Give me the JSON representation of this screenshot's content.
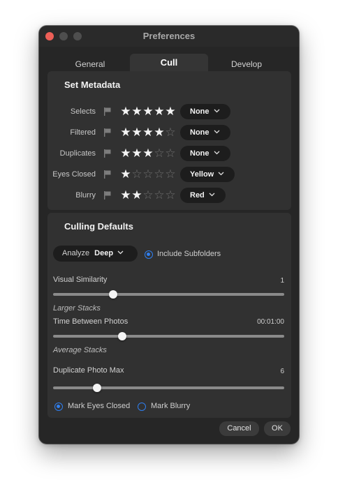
{
  "window": {
    "title": "Preferences"
  },
  "tabs": [
    {
      "label": "General",
      "active": false
    },
    {
      "label": "Cull",
      "active": true
    },
    {
      "label": "Develop",
      "active": false
    }
  ],
  "set_metadata": {
    "title": "Set Metadata",
    "rows": [
      {
        "label": "Selects",
        "stars": 5,
        "color_label": "None"
      },
      {
        "label": "Filtered",
        "stars": 4,
        "color_label": "None"
      },
      {
        "label": "Duplicates",
        "stars": 3,
        "color_label": "None"
      },
      {
        "label": "Eyes Closed",
        "stars": 1,
        "color_label": "Yellow"
      },
      {
        "label": "Blurry",
        "stars": 2,
        "color_label": "Red"
      }
    ],
    "max_stars": 5
  },
  "culling_defaults": {
    "title": "Culling Defaults",
    "analyze": {
      "label": "Analyze",
      "value": "Deep"
    },
    "include_subfolders": {
      "label": "Include Subfolders",
      "checked": true
    },
    "visual_similarity": {
      "label": "Visual Similarity",
      "value": "1",
      "level": 0.26
    },
    "larger_stacks_label": "Larger Stacks",
    "time_between_photos": {
      "label": "Time Between Photos",
      "value": "00:01:00",
      "level": 0.3
    },
    "average_stacks_label": "Average Stacks",
    "duplicate_photo_max": {
      "label": "Duplicate Photo Max",
      "value": "6",
      "level": 0.19
    },
    "mark_eyes_closed": {
      "label": "Mark Eyes Closed",
      "checked": true
    },
    "mark_blurry": {
      "label": "Mark Blurry",
      "checked": false
    }
  },
  "buttons": {
    "cancel": "Cancel",
    "ok": "OK"
  },
  "colors": {
    "accent": "#2f7ff0",
    "close": "#ed5f57",
    "background": "#262626",
    "panel": "#313131"
  }
}
